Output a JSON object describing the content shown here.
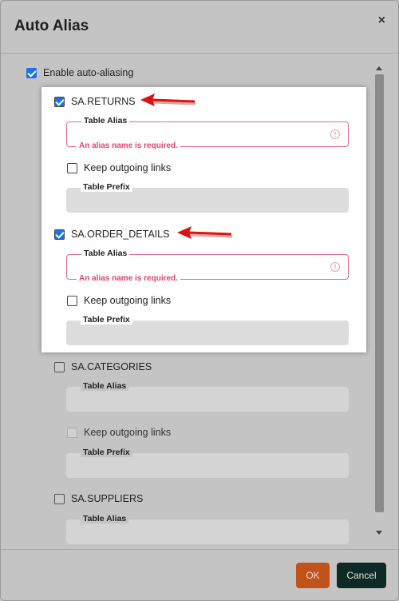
{
  "dialog": {
    "title": "Auto Alias",
    "close_glyph": "×",
    "enable_label": "Enable auto-aliasing"
  },
  "tables": [
    {
      "name": "SA.RETURNS",
      "checked": true,
      "alias_label": "Table Alias",
      "error": "An alias name is required.",
      "keep_label": "Keep outgoing links",
      "prefix_label": "Table Prefix"
    },
    {
      "name": "SA.ORDER_DETAILS",
      "checked": true,
      "alias_label": "Table Alias",
      "error": "An alias name is required.",
      "keep_label": "Keep outgoing links",
      "prefix_label": "Table Prefix"
    },
    {
      "name": "SA.CATEGORIES",
      "checked": false,
      "alias_label": "Table Alias",
      "keep_label": "Keep outgoing links",
      "prefix_label": "Table Prefix"
    },
    {
      "name": "SA.SUPPLIERS",
      "checked": false,
      "alias_label": "Table Alias"
    }
  ],
  "footer": {
    "ok_label": "OK",
    "cancel_label": "Cancel"
  },
  "colors": {
    "accent_checkbox": "#1a73e8",
    "error": "#e0436f",
    "ok_button": "#c0521c",
    "cancel_button": "#0e2a26",
    "annotation_arrow": "#e01010"
  },
  "icons": {
    "close": "close-icon",
    "error": "error-circle-icon",
    "arrow": "red-arrow-annotation"
  }
}
